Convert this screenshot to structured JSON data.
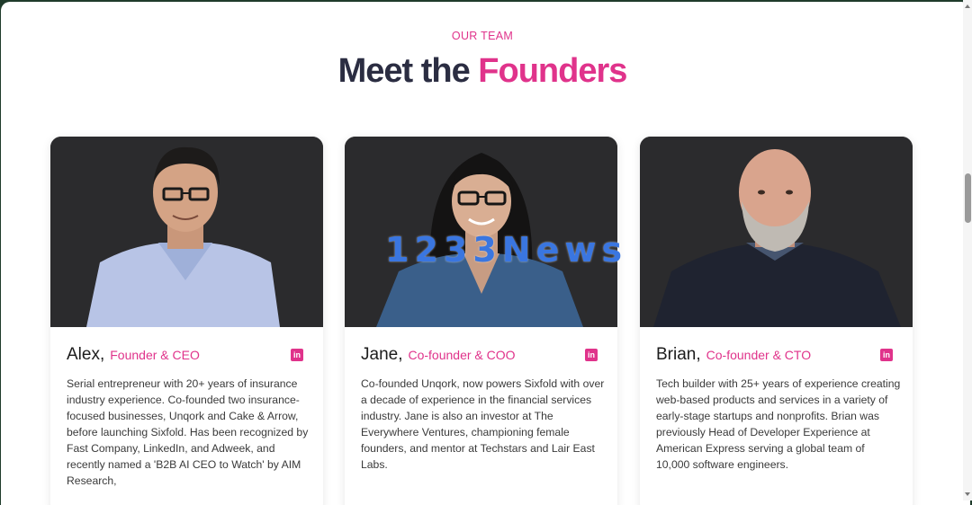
{
  "section": {
    "eyebrow": "OUR TEAM",
    "headline_plain": "Meet the ",
    "headline_accent": "Founders"
  },
  "colors": {
    "accent": "#e0338b",
    "heading": "#2b2d42",
    "photo_bg": "#2b2b2d"
  },
  "founders": [
    {
      "name": "Alex,",
      "role": "Founder & CEO",
      "linkedin_icon": "linkedin-icon",
      "bio": "Serial entrepreneur with 20+ years of insurance industry experience. Co-founded two insurance-focused businesses, Unqork and Cake & Arrow, before launching Sixfold. Has been recognized by Fast Company, LinkedIn, and Adweek, and recently named a 'B2B AI CEO to Watch' by AIM Research,"
    },
    {
      "name": "Jane,",
      "role": "Co-founder & COO",
      "linkedin_icon": "linkedin-icon",
      "bio": "Co-founded Unqork, now powers Sixfold with over a decade of experience in the financial services industry. Jane is also an investor at The Everywhere Ventures, championing female founders, and mentor at Techstars and Lair East Labs."
    },
    {
      "name": "Brian,",
      "role": "Co-founder & CTO",
      "linkedin_icon": "linkedin-icon",
      "bio": "Tech builder with 25+ years of experience creating web-based products and services in a variety of early-stage startups and nonprofits. Brian was previously Head of Developer Experience at American Express serving a global team of 10,000 software engineers."
    }
  ],
  "watermark": "1233News"
}
